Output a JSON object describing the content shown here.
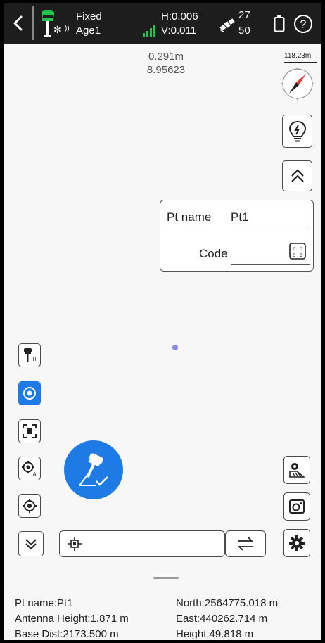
{
  "status_bar": {
    "fix_status": "Fixed",
    "age": "Age1",
    "h_precision": "H:0.006",
    "v_precision": "V:0.011",
    "sats_used": "27",
    "sats_total": "50"
  },
  "map": {
    "distance": "0.291m",
    "bearing": "8.95623",
    "scale": "118.23m"
  },
  "point_panel": {
    "pt_name_label": "Pt name",
    "pt_name_value": "Pt1",
    "code_label": "Code",
    "code_value": ""
  },
  "info": {
    "pt_name": "Pt name:Pt1",
    "antenna_height": "Antenna Height:1.871 m",
    "base_dist": "Base Dist:2173.500 m",
    "north": "North:2564775.018 m",
    "east": "East:440262.714 m",
    "height": "Height:49.818 m"
  },
  "icons": [
    "back-icon",
    "gnss-receiver-icon",
    "bluetooth-icon",
    "signal-bars-icon",
    "satellite-icon",
    "battery-icon",
    "help-icon",
    "compass-icon",
    "bulb-icon",
    "double-chevron-up-icon",
    "code-icon",
    "antenna-height-icon",
    "stakeout-point-icon",
    "zoom-extent-icon",
    "target-a-icon",
    "locate-icon",
    "double-chevron-down-icon",
    "point-marker-icon",
    "swap-icon",
    "map-layer-icon",
    "camera-icon",
    "settings-icon",
    "survey-point-icon"
  ],
  "colors": {
    "accent": "#1e7be6",
    "topbar": "#1d1d1d",
    "signal": "#22c34a",
    "compass_needle": "#e53935"
  }
}
